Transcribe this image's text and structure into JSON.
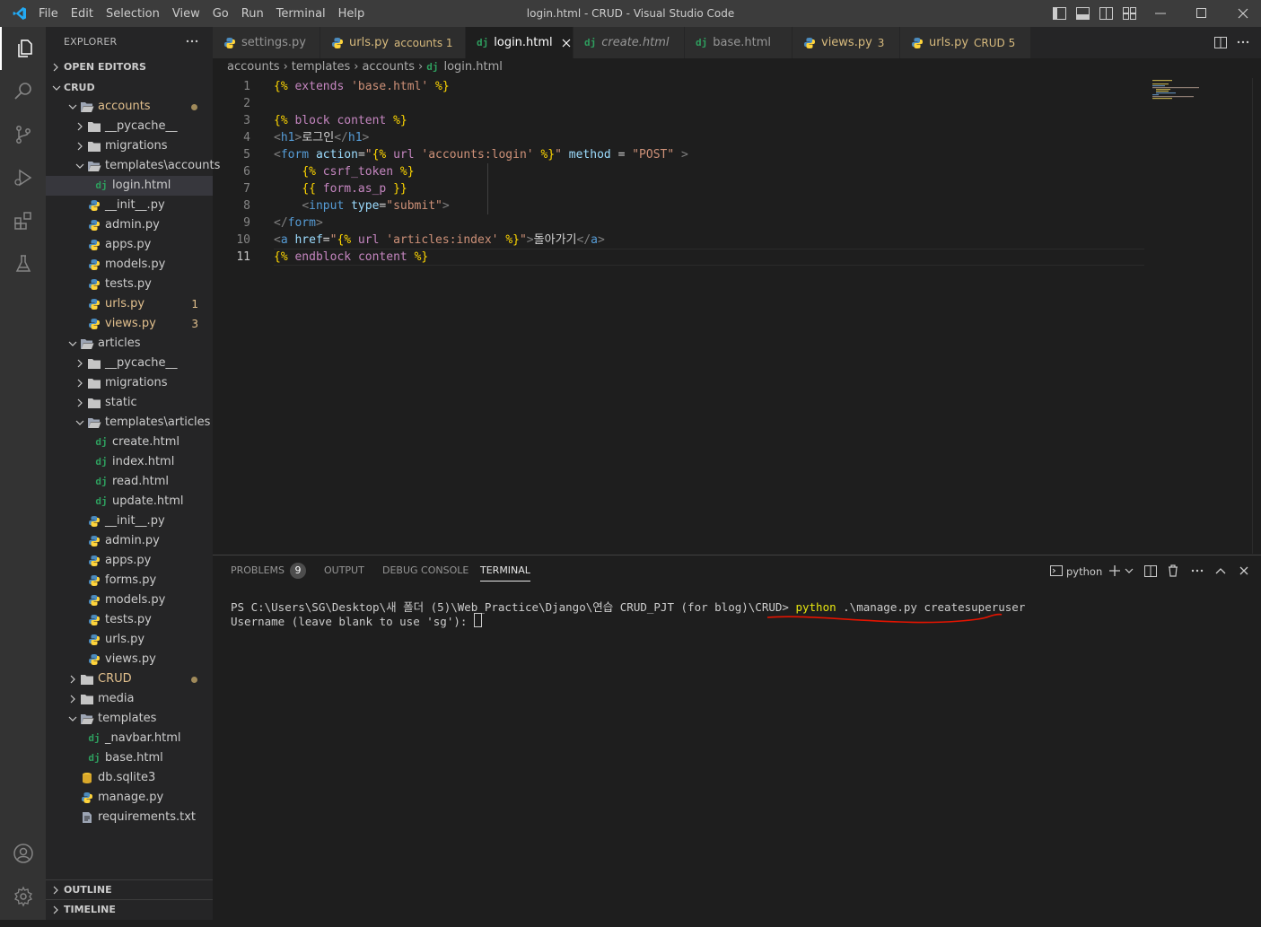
{
  "app": {
    "window_title": "login.html - CRUD - Visual Studio Code",
    "menu": [
      "File",
      "Edit",
      "Selection",
      "View",
      "Go",
      "Run",
      "Terminal",
      "Help"
    ]
  },
  "sidebar": {
    "header": "EXPLORER",
    "open_editors": "OPEN EDITORS",
    "project": "CRUD",
    "outline": "OUTLINE",
    "timeline": "TIMELINE",
    "tree": [
      {
        "name": "accounts",
        "badge": "",
        "icon": "folder-open-icon"
      },
      {
        "name": "__pycache__",
        "badge": "",
        "icon": "folder-icon"
      },
      {
        "name": "migrations",
        "badge": "",
        "icon": "folder-icon"
      },
      {
        "name": "templates\\accounts",
        "badge": "",
        "icon": "folder-open-icon"
      },
      {
        "name": "login.html",
        "badge": "",
        "icon": "django-icon"
      },
      {
        "name": "__init__.py",
        "badge": "",
        "icon": "python-icon"
      },
      {
        "name": "admin.py",
        "badge": "",
        "icon": "python-icon"
      },
      {
        "name": "apps.py",
        "badge": "",
        "icon": "python-icon"
      },
      {
        "name": "models.py",
        "badge": "",
        "icon": "python-icon"
      },
      {
        "name": "tests.py",
        "badge": "",
        "icon": "python-icon"
      },
      {
        "name": "urls.py",
        "badge": "1",
        "icon": "python-icon"
      },
      {
        "name": "views.py",
        "badge": "3",
        "icon": "python-icon"
      },
      {
        "name": "articles",
        "badge": "",
        "icon": "folder-open-icon"
      },
      {
        "name": "__pycache__",
        "badge": "",
        "icon": "folder-icon"
      },
      {
        "name": "migrations",
        "badge": "",
        "icon": "folder-icon"
      },
      {
        "name": "static",
        "badge": "",
        "icon": "folder-icon"
      },
      {
        "name": "templates\\articles",
        "badge": "",
        "icon": "folder-open-icon"
      },
      {
        "name": "create.html",
        "badge": "",
        "icon": "django-icon"
      },
      {
        "name": "index.html",
        "badge": "",
        "icon": "django-icon"
      },
      {
        "name": "read.html",
        "badge": "",
        "icon": "django-icon"
      },
      {
        "name": "update.html",
        "badge": "",
        "icon": "django-icon"
      },
      {
        "name": "__init__.py",
        "badge": "",
        "icon": "python-icon"
      },
      {
        "name": "admin.py",
        "badge": "",
        "icon": "python-icon"
      },
      {
        "name": "apps.py",
        "badge": "",
        "icon": "python-icon"
      },
      {
        "name": "forms.py",
        "badge": "",
        "icon": "python-icon"
      },
      {
        "name": "models.py",
        "badge": "",
        "icon": "python-icon"
      },
      {
        "name": "tests.py",
        "badge": "",
        "icon": "python-icon"
      },
      {
        "name": "urls.py",
        "badge": "",
        "icon": "python-icon"
      },
      {
        "name": "views.py",
        "badge": "",
        "icon": "python-icon"
      },
      {
        "name": "CRUD",
        "badge": "",
        "icon": "folder-icon"
      },
      {
        "name": "media",
        "badge": "",
        "icon": "folder-icon"
      },
      {
        "name": "templates",
        "badge": "",
        "icon": "folder-open-icon"
      },
      {
        "name": "_navbar.html",
        "badge": "",
        "icon": "django-icon"
      },
      {
        "name": "base.html",
        "badge": "",
        "icon": "django-icon"
      },
      {
        "name": "db.sqlite3",
        "badge": "",
        "icon": "database-icon"
      },
      {
        "name": "manage.py",
        "badge": "",
        "icon": "python-icon"
      },
      {
        "name": "requirements.txt",
        "badge": "",
        "icon": "text-file-icon"
      }
    ]
  },
  "tabs": [
    {
      "label": "settings.py",
      "sub": ""
    },
    {
      "label": "urls.py",
      "sub": "accounts 1"
    },
    {
      "label": "login.html",
      "sub": ""
    },
    {
      "label": "create.html",
      "sub": ""
    },
    {
      "label": "base.html",
      "sub": ""
    },
    {
      "label": "views.py",
      "sub": "3"
    },
    {
      "label": "urls.py",
      "sub": "CRUD 5"
    }
  ],
  "breadcrumb": [
    "accounts",
    "templates",
    "accounts",
    "login.html"
  ],
  "editor": {
    "line_numbers": [
      "1",
      "2",
      "3",
      "4",
      "5",
      "6",
      "7",
      "8",
      "9",
      "10",
      "11"
    ],
    "lines": [
      "{% extends 'base.html' %}",
      "",
      "{% block content %}",
      "<h1>로그인</h1>",
      "<form action=\"{% url 'accounts:login' %}\" method = \"POST\" >",
      "    {% csrf_token %}",
      "    {{ form.as_p }}",
      "    <input type=\"submit\">",
      "</form>",
      "<a href=\"{% url 'articles:index' %}\">돌아가기</a>",
      "{% endblock content %}"
    ]
  },
  "panel": {
    "tabs": [
      "PROBLEMS",
      "OUTPUT",
      "DEBUG CONSOLE",
      "TERMINAL"
    ],
    "problems_count": "9",
    "terminal_name": "python",
    "terminal_lines": {
      "prompt": "PS C:\\Users\\SG\\Desktop\\새 폴더 (5)\\Web_Practice\\Django\\연습 CRUD_PJT (for blog)\\CRUD>",
      "cmd_python": "python",
      "cmd_rest": ".\\manage.py createsuperuser",
      "line2": "Username (leave blank to use 'sg'): "
    }
  },
  "colors": {
    "accent": "#007acc",
    "modified_folder": "#e2c08d",
    "error_text": "#e2c08d",
    "annotation_red": "#e51400"
  }
}
